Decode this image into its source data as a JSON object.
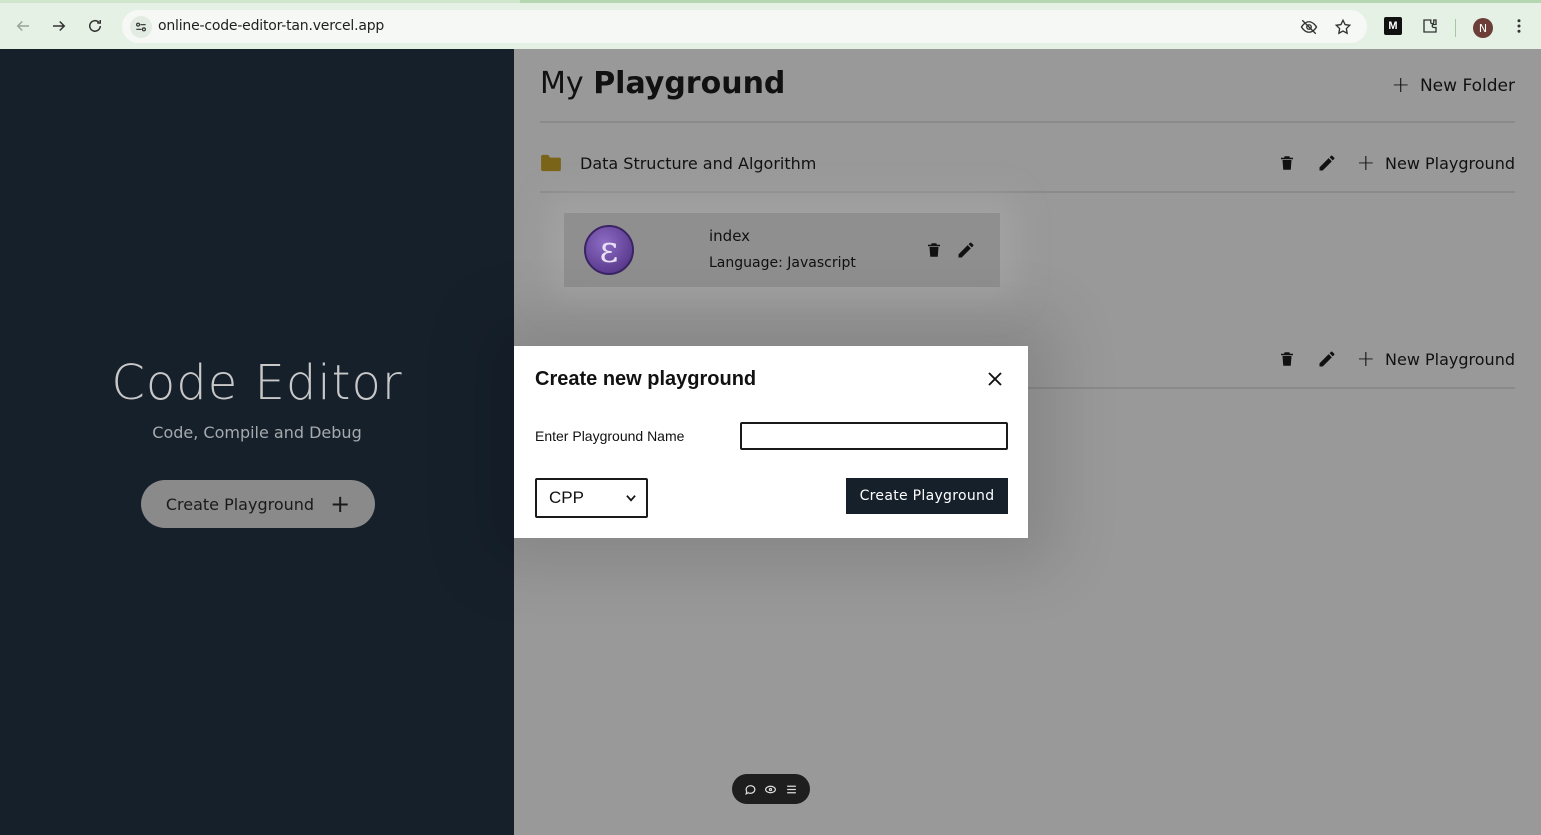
{
  "browser": {
    "url": "online-code-editor-tan.vercel.app",
    "extension_badge": "M",
    "profile_initial": "N",
    "icons": [
      "back-icon",
      "forward-icon",
      "reload-icon",
      "site-settings-icon",
      "eye-off-icon",
      "star-icon",
      "extensions-icon",
      "more-vert-icon"
    ]
  },
  "left": {
    "title": "Code Editor",
    "subtitle": "Code, Compile and Debug",
    "create_button": "Create Playground",
    "create_button_icon": "+"
  },
  "main": {
    "title_light": "My",
    "title_bold": "Playground",
    "new_folder_label": "New Folder",
    "new_folder_icon": "+",
    "folders": [
      {
        "name": "Data Structure and Algorithm",
        "new_playground_label": "New Playground",
        "cards": [
          {
            "name": "index",
            "language": "Language: Javascript"
          }
        ]
      },
      {
        "name": "",
        "new_playground_label": "New Playground"
      }
    ]
  },
  "modal": {
    "title": "Create new playground",
    "name_label": "Enter Playground Name",
    "name_value": "",
    "language_selected": "CPP",
    "submit_label": "Create Playground"
  },
  "colors": {
    "sidebar_bg": "#16202b",
    "overlay_bg": "#999999",
    "folder_color": "#d4a017",
    "button_dark": "#16202b"
  }
}
